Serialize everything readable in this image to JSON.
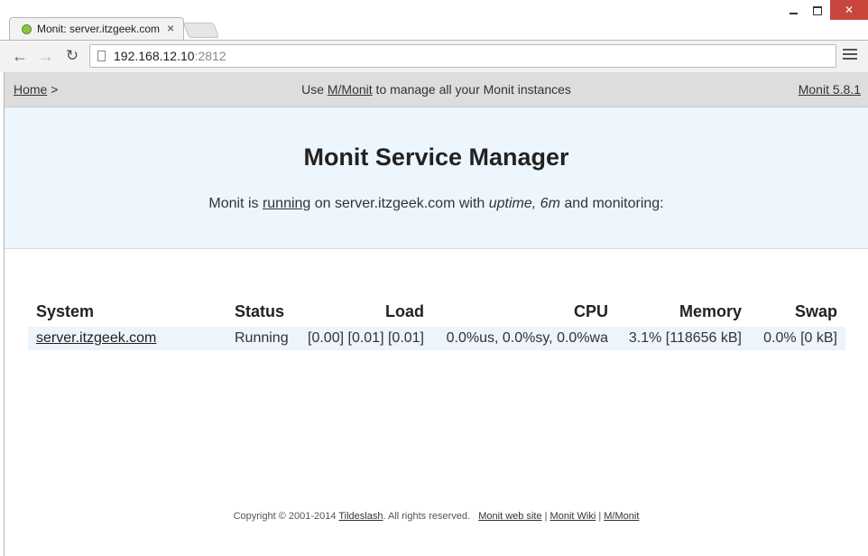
{
  "browser": {
    "tab_title": "Monit: server.itzgeek.com",
    "tab_close": "×",
    "url_host": "192.168.12.10",
    "url_port": ":2812",
    "back_glyph": "←",
    "forward_glyph": "→",
    "reload_glyph": "↻",
    "close_glyph": "✕"
  },
  "nav": {
    "home": "Home",
    "home_sep": " >",
    "mid_prefix": "Use ",
    "mid_link": "M/Monit",
    "mid_suffix": " to manage all your Monit instances",
    "version": "Monit 5.8.1"
  },
  "header": {
    "title": "Monit Service Manager",
    "sub_prefix": "Monit is ",
    "sub_link": "running",
    "sub_mid": " on server.itzgeek.com with ",
    "sub_uptime": "uptime, 6m",
    "sub_suffix": "  and monitoring:"
  },
  "table": {
    "headers": {
      "system": "System",
      "status": "Status",
      "load": "Load",
      "cpu": "CPU",
      "memory": "Memory",
      "swap": "Swap"
    },
    "rows": [
      {
        "system": "server.itzgeek.com",
        "status": "Running",
        "load": "[0.00] [0.01] [0.01]",
        "cpu": "0.0%us, 0.0%sy, 0.0%wa",
        "memory": "3.1% [118656 kB]",
        "swap": "0.0% [0 kB]"
      }
    ]
  },
  "footer": {
    "copyright": "Copyright © 2001-2014 ",
    "company": "Tildeslash",
    "rights": ". All rights reserved.   ",
    "link_site": "Monit web site",
    "sep1": " | ",
    "link_wiki": "Monit Wiki",
    "sep2": " | ",
    "link_mmonit": "M/Monit"
  },
  "colors": {
    "running": "#2ad02a",
    "header_bg": "#eef6fd",
    "nav_bg": "#dddddd",
    "row_bg": "#eef4fb"
  }
}
